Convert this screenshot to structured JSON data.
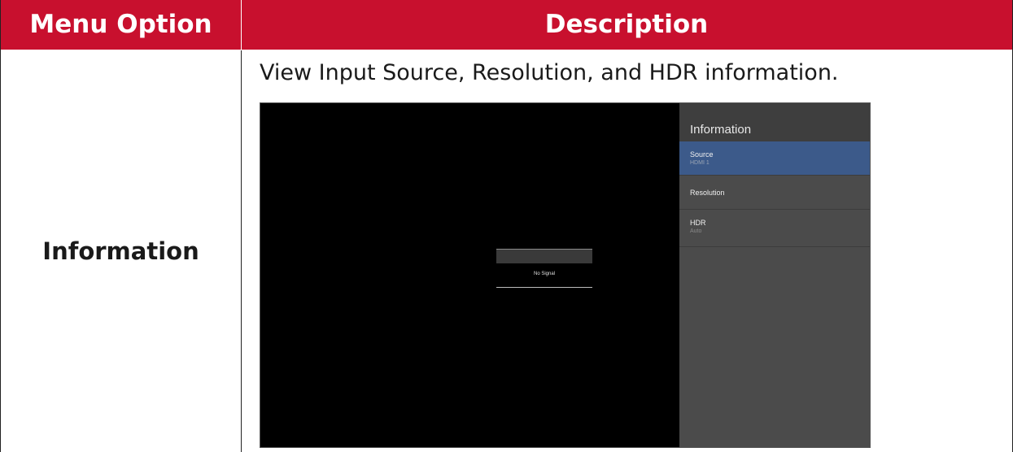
{
  "table": {
    "header": {
      "menu_option": "Menu Option",
      "description": "Description"
    },
    "row": {
      "option": "Information",
      "description": "View Input Source, Resolution, and HDR information."
    }
  },
  "screenshot": {
    "no_signal": "No Signal",
    "panel": {
      "title": "Information",
      "items": [
        {
          "label": "Source",
          "value": "HDMI 1",
          "selected": true
        },
        {
          "label": "Resolution",
          "value": "",
          "selected": false
        },
        {
          "label": "HDR",
          "value": "Auto",
          "selected": false
        }
      ]
    }
  },
  "colors": {
    "header_bg": "#c8102e",
    "panel_bg": "#4b4b4b",
    "selected_item_bg": "#3c5a8a"
  }
}
